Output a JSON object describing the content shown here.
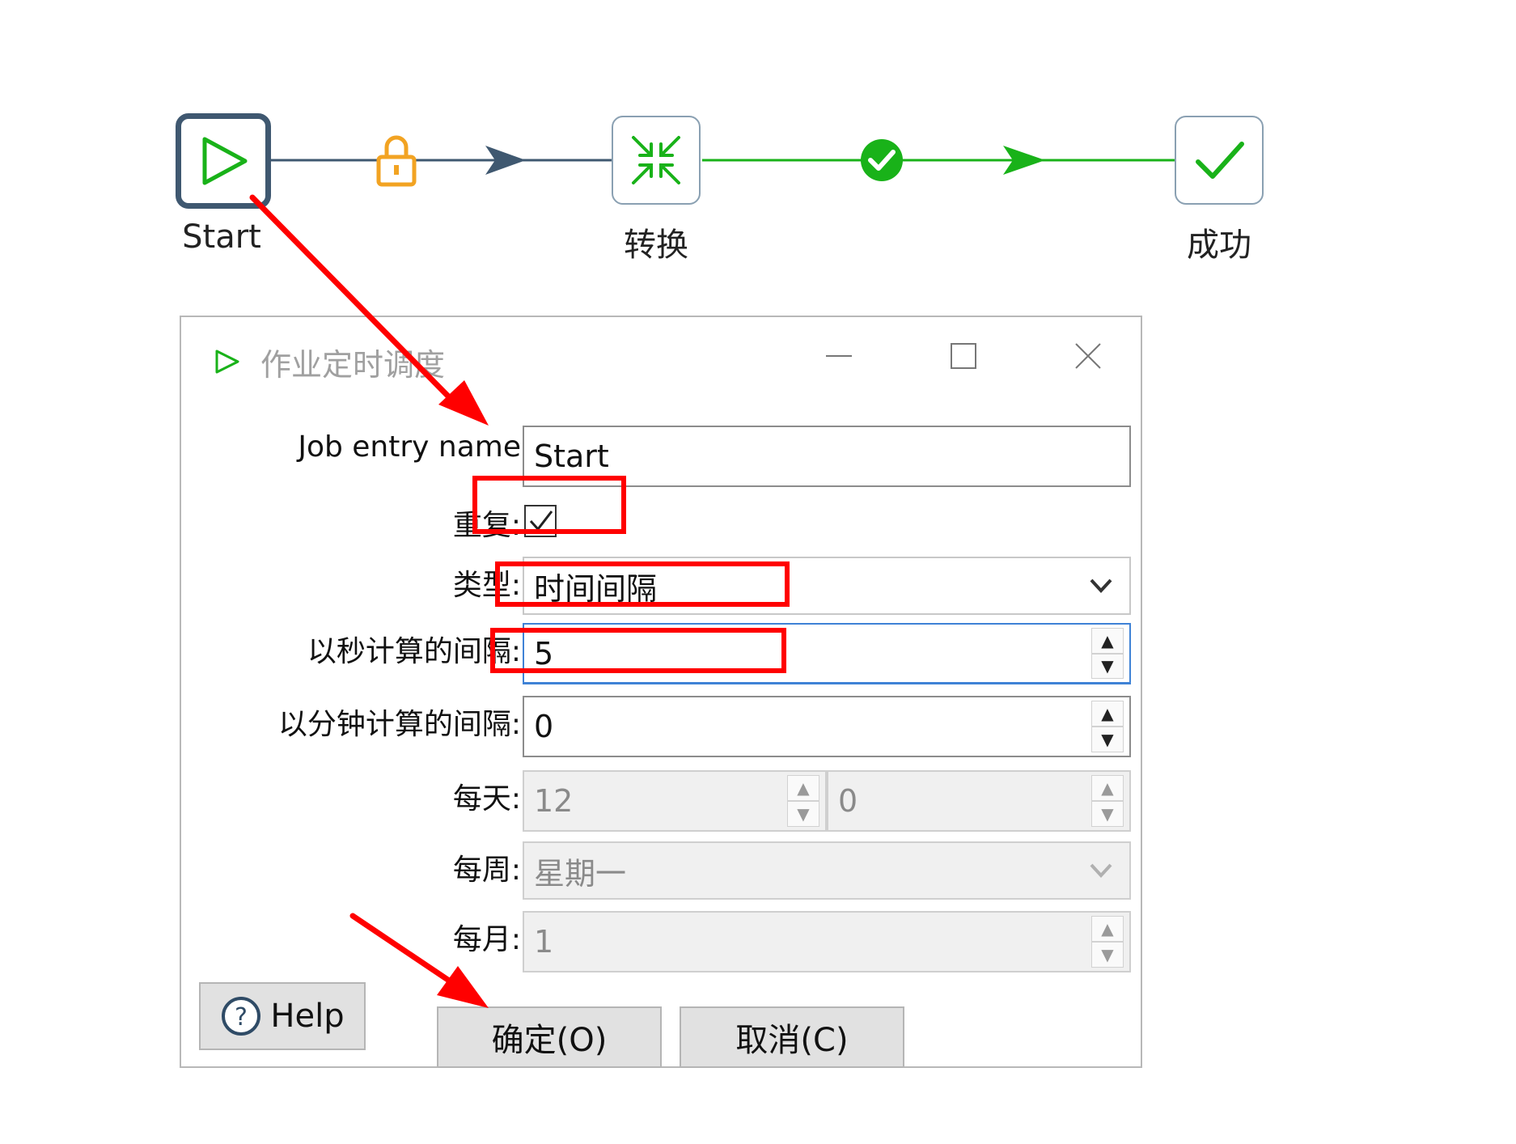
{
  "canvas": {
    "nodes": [
      {
        "label": "Start",
        "icon": "start-play-icon"
      },
      {
        "label": "转换",
        "icon": "transformation-icon"
      },
      {
        "label": "成功",
        "icon": "success-check-icon"
      }
    ],
    "hops": [
      {
        "from": "Start",
        "to": "转换",
        "status_icon": "lock-icon",
        "color": "#3f5870"
      },
      {
        "from": "转换",
        "to": "成功",
        "status_icon": "success-circle-icon",
        "color": "#19b219"
      }
    ]
  },
  "dialog": {
    "title": "作业定时调度",
    "title_icon": "play-outline-icon",
    "fields": {
      "job_entry_name": {
        "label": "Job entry name",
        "value": "Start"
      },
      "repeat": {
        "label": "重复:",
        "checked": true
      },
      "type": {
        "label": "类型:",
        "value": "时间间隔"
      },
      "interval_seconds": {
        "label": "以秒计算的间隔:",
        "value": "5"
      },
      "interval_minutes": {
        "label": "以分钟计算的间隔:",
        "value": "0"
      },
      "daily": {
        "label": "每天:",
        "hour": "12",
        "minute": "0"
      },
      "weekly": {
        "label": "每周:",
        "value": "星期一"
      },
      "monthly": {
        "label": "每月:",
        "value": "1"
      }
    },
    "buttons": {
      "help": "Help",
      "ok": "确定(O)",
      "cancel": "取消(C)"
    }
  },
  "annotation_color": "#ff0000"
}
